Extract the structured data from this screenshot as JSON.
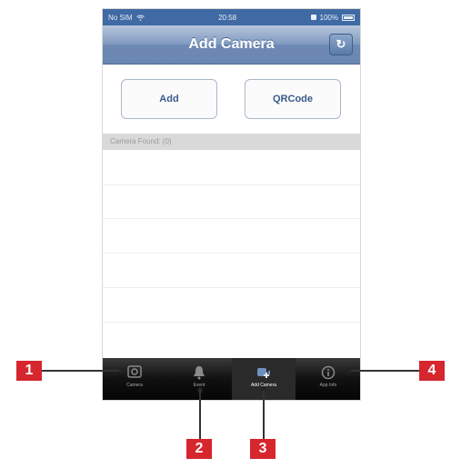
{
  "status_bar": {
    "carrier": "No SIM",
    "time": "20:58",
    "battery": "100%"
  },
  "nav": {
    "title": "Add Camera",
    "refresh_icon": "refresh-icon"
  },
  "buttons": {
    "add_label": "Add",
    "qrcode_label": "QRCode"
  },
  "list": {
    "section_header": "Camera Found: (0)"
  },
  "tab_bar": {
    "tabs": [
      {
        "label": "Camera",
        "icon": "camera-icon"
      },
      {
        "label": "Event",
        "icon": "bell-icon"
      },
      {
        "label": "Add Camera",
        "icon": "add-camera-icon",
        "selected": true
      },
      {
        "label": "App Info",
        "icon": "info-icon"
      }
    ]
  },
  "callouts": [
    "1",
    "2",
    "3",
    "4"
  ],
  "colors": {
    "nav_blue": "#6a86b1",
    "tab_bar": "#111111",
    "callout_red": "#d6262e"
  }
}
